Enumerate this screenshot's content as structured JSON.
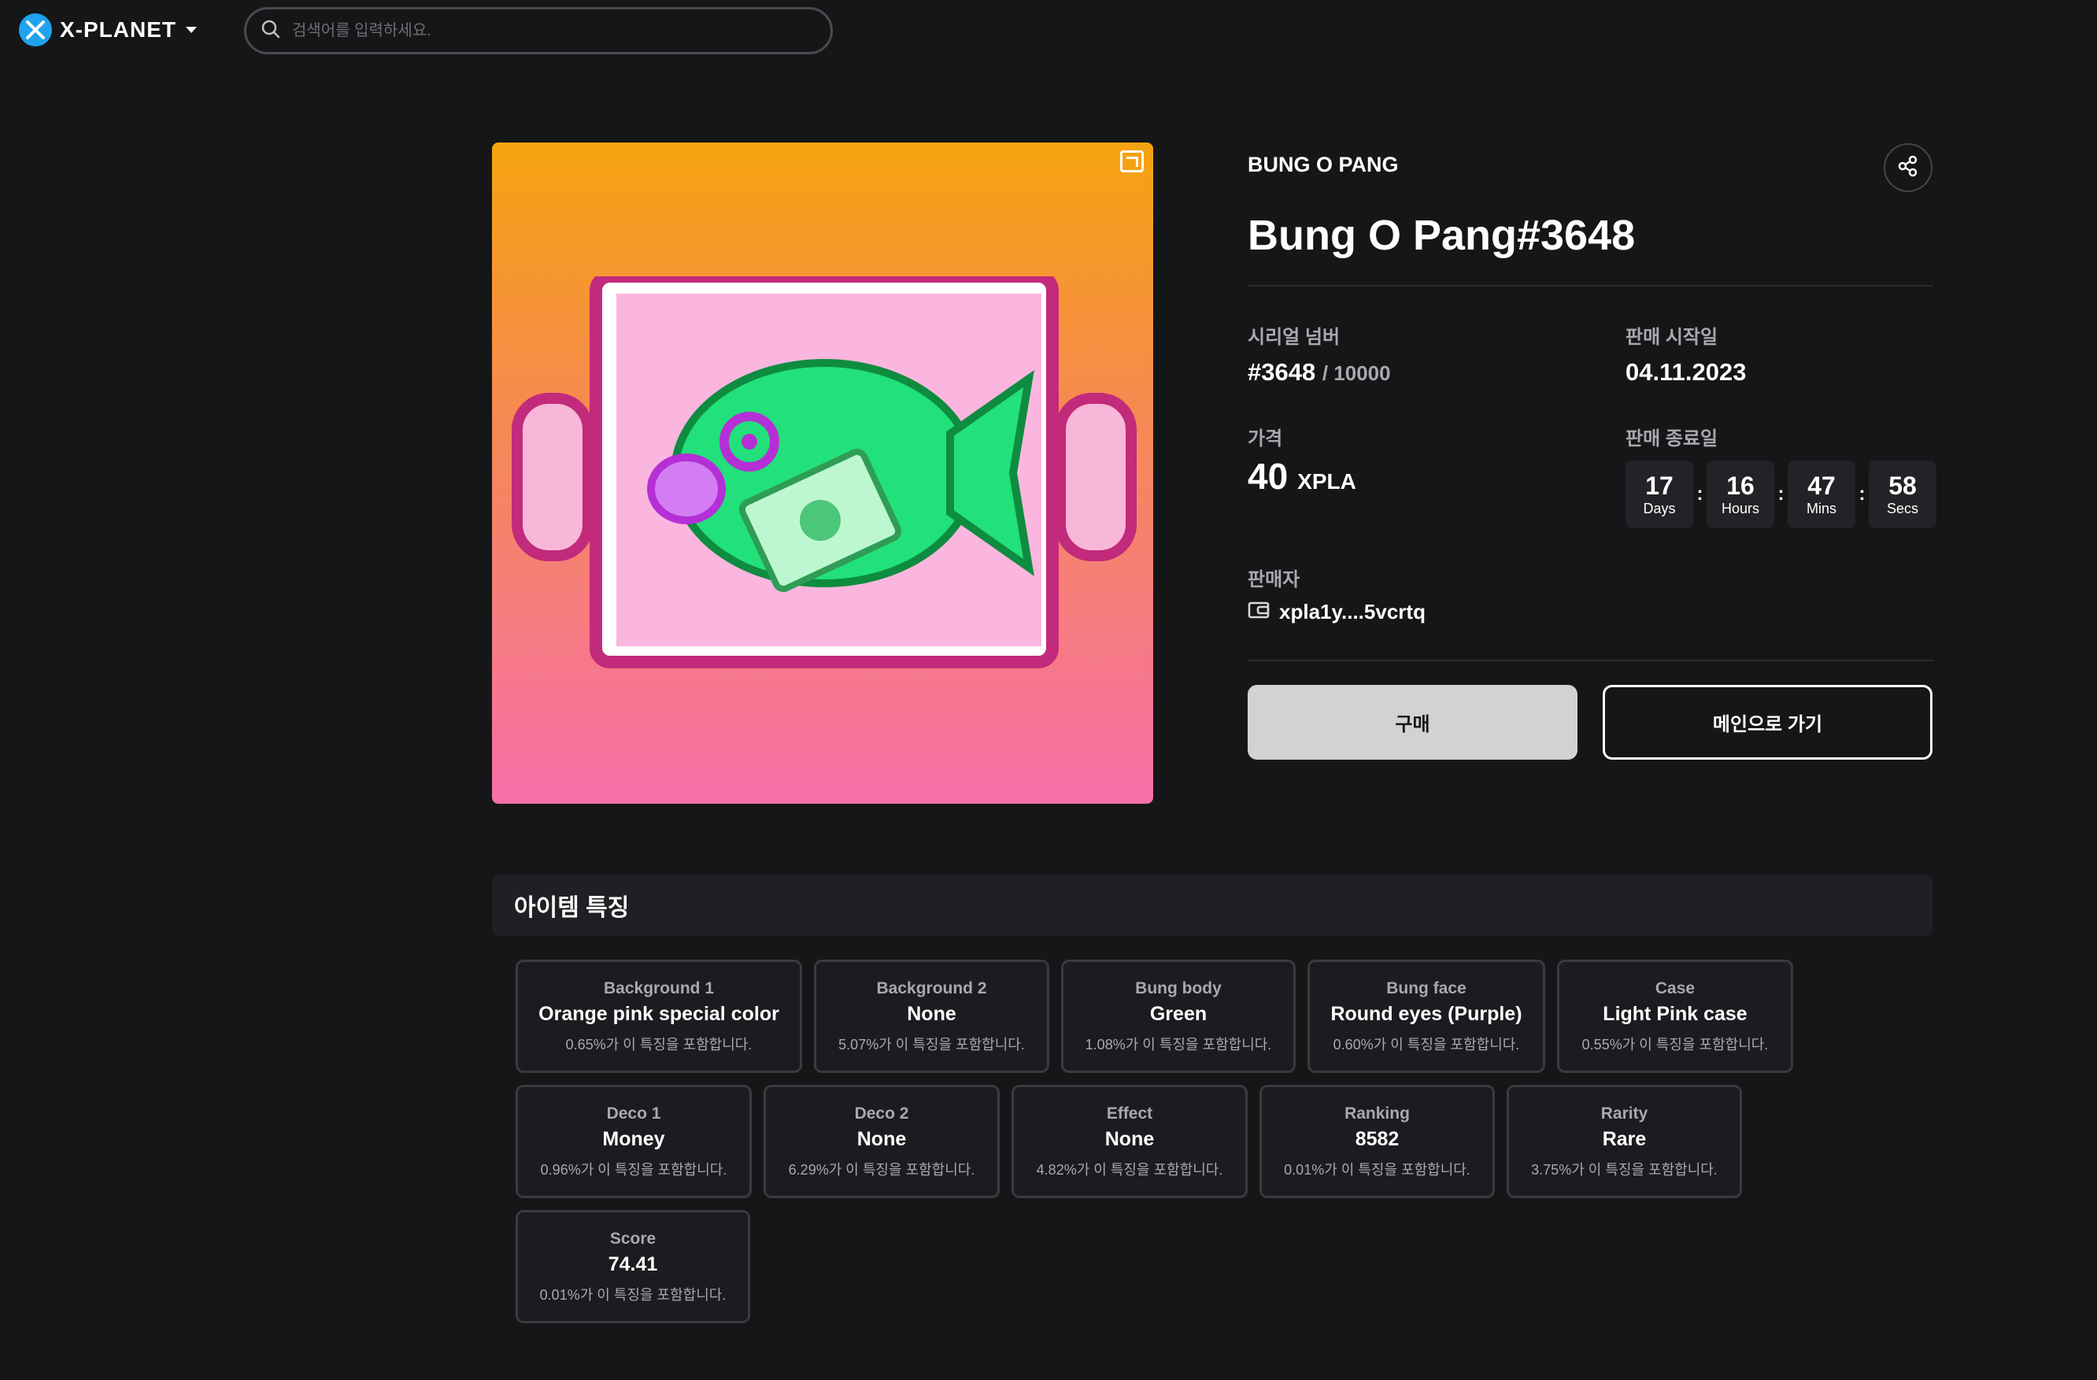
{
  "header": {
    "logo_text": "X-PLANET",
    "search_placeholder": "검색어를 입력하세요."
  },
  "nft": {
    "collection": "BUNG O PANG",
    "title": "Bung O Pang#3648",
    "serial_label": "시리얼 넘버",
    "serial_number": "#3648",
    "serial_total": "/ 10000",
    "sale_start_label": "판매 시작일",
    "sale_start": "04.11.2023",
    "price_label": "가격",
    "price_value": "40",
    "price_unit": "XPLA",
    "sale_end_label": "판매 종료일",
    "countdown": {
      "days": "17",
      "days_label": "Days",
      "hours": "16",
      "hours_label": "Hours",
      "mins": "47",
      "mins_label": "Mins",
      "secs": "58",
      "secs_label": "Secs"
    },
    "seller_label": "판매자",
    "seller_address": "xpla1y....5vcrtq",
    "buy_button": "구매",
    "main_button": "메인으로 가기"
  },
  "traits": {
    "title": "아이템 특징",
    "items": [
      {
        "name": "Background 1",
        "value": "Orange pink special color",
        "pct": "0.65%가 이 특징을 포함합니다."
      },
      {
        "name": "Background 2",
        "value": "None",
        "pct": "5.07%가 이 특징을 포함합니다."
      },
      {
        "name": "Bung body",
        "value": "Green",
        "pct": "1.08%가 이 특징을 포함합니다."
      },
      {
        "name": "Bung face",
        "value": "Round eyes (Purple)",
        "pct": "0.60%가 이 특징을 포함합니다."
      },
      {
        "name": "Case",
        "value": "Light Pink case",
        "pct": "0.55%가 이 특징을 포함합니다."
      },
      {
        "name": "Deco 1",
        "value": "Money",
        "pct": "0.96%가 이 특징을 포함합니다."
      },
      {
        "name": "Deco 2",
        "value": "None",
        "pct": "6.29%가 이 특징을 포함합니다."
      },
      {
        "name": "Effect",
        "value": "None",
        "pct": "4.82%가 이 특징을 포함합니다."
      },
      {
        "name": "Ranking",
        "value": "8582",
        "pct": "0.01%가 이 특징을 포함합니다."
      },
      {
        "name": "Rarity",
        "value": "Rare",
        "pct": "3.75%가 이 특징을 포함합니다."
      },
      {
        "name": "Score",
        "value": "74.41",
        "pct": "0.01%가 이 특징을 포함합니다."
      }
    ]
  },
  "colors": {
    "background": "#151618",
    "accent": "#1fa3ee",
    "buy_button": "#d2d2d2"
  }
}
